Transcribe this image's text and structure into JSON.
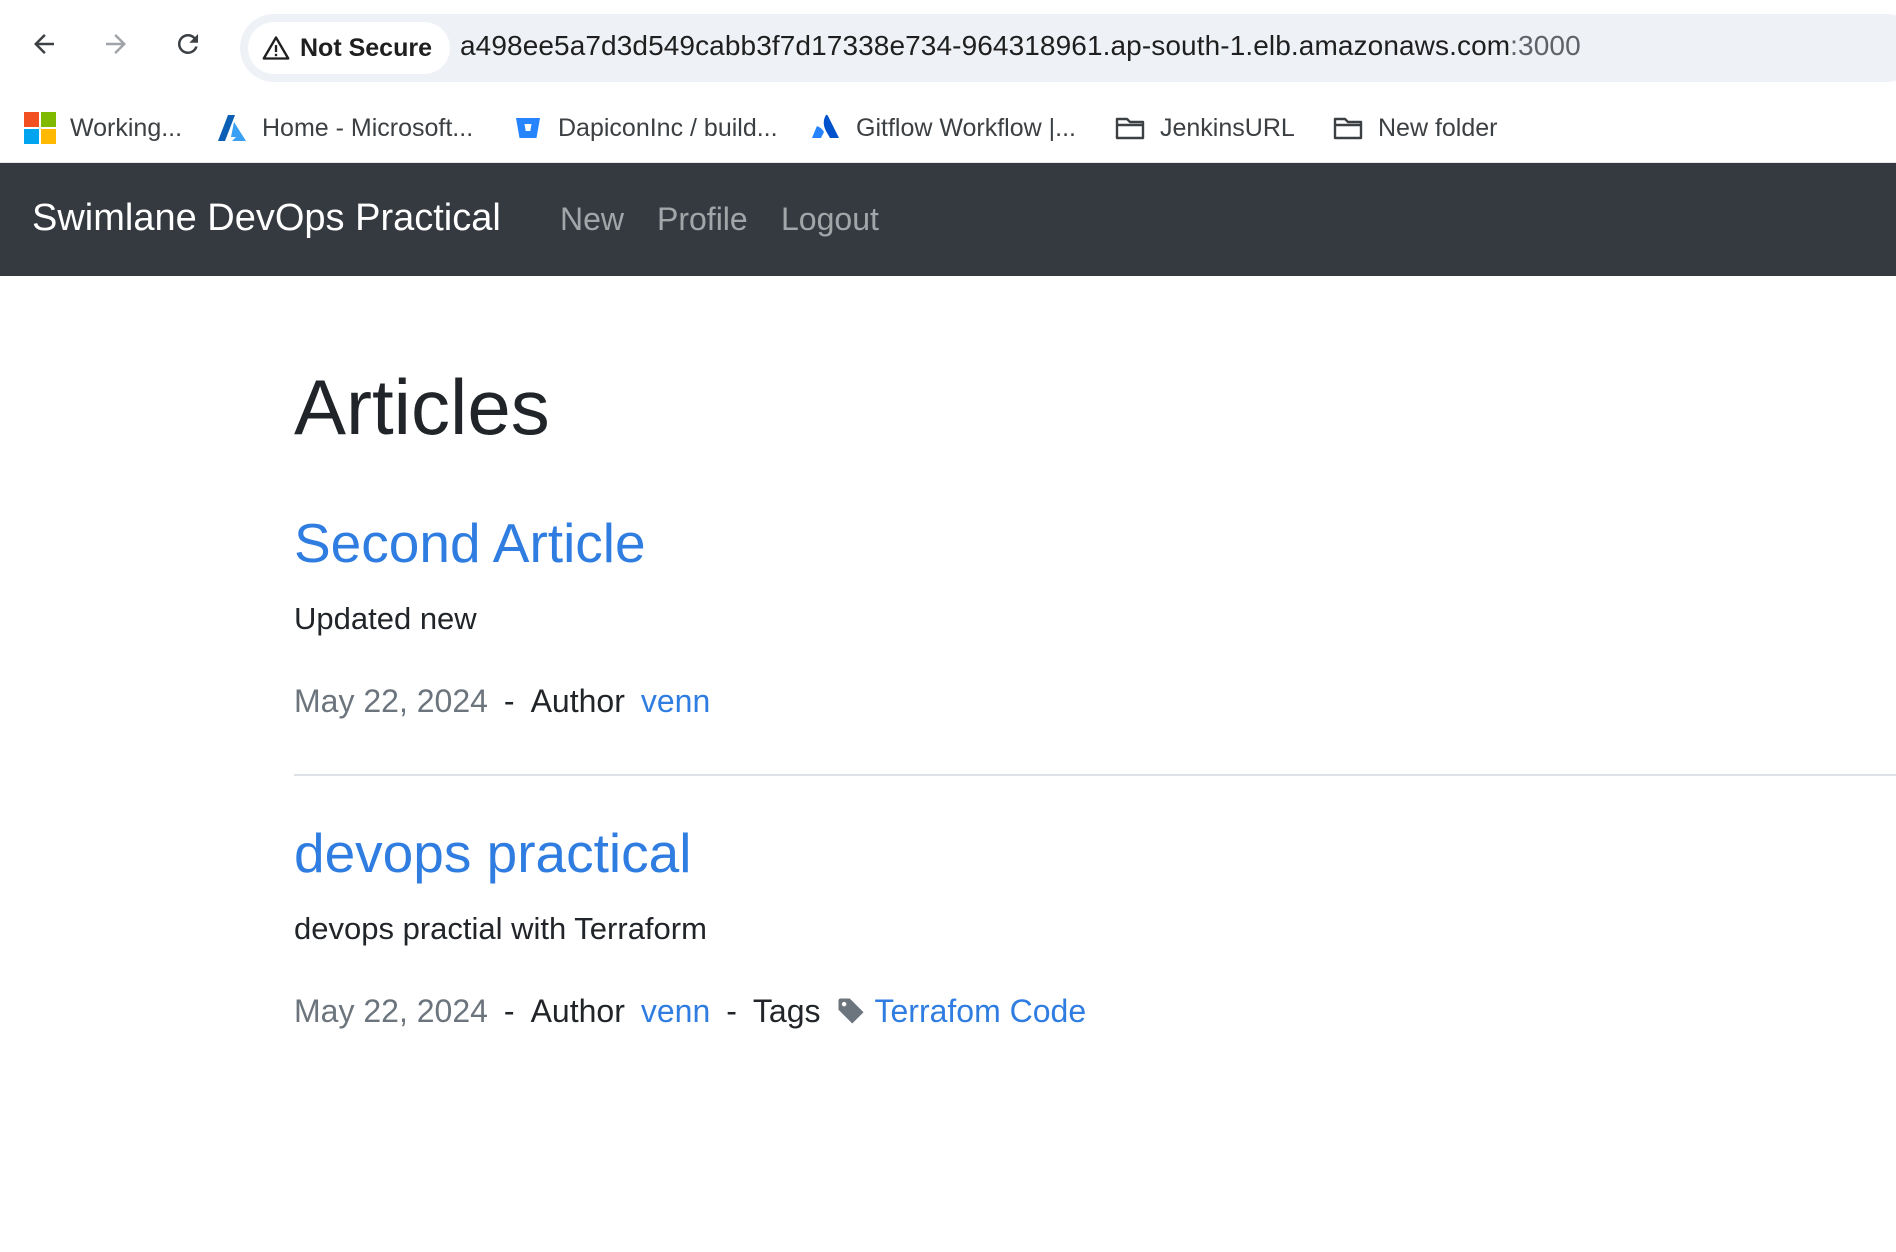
{
  "browser": {
    "security_label": "Not Secure",
    "url_host": "a498ee5a7d3d549cabb3f7d17338e734-964318961.ap-south-1.elb.amazonaws.com",
    "url_port": ":3000",
    "bookmarks": [
      {
        "label": "Working...",
        "icon": "microsoft-logo-icon"
      },
      {
        "label": "Home - Microsoft...",
        "icon": "azure-icon"
      },
      {
        "label": "DapiconInc / build...",
        "icon": "bitbucket-icon"
      },
      {
        "label": "Gitflow Workflow |...",
        "icon": "atlassian-icon"
      },
      {
        "label": "JenkinsURL",
        "icon": "folder-icon"
      },
      {
        "label": "New folder",
        "icon": "folder-icon"
      }
    ]
  },
  "navbar": {
    "brand": "Swimlane DevOps Practical",
    "links": [
      "New",
      "Profile",
      "Logout"
    ]
  },
  "page": {
    "title": "Articles"
  },
  "articles": [
    {
      "title": "Second Article",
      "description": "Updated new",
      "date": "May 22, 2024",
      "sep": "-",
      "author_label": "Author",
      "author": "venn"
    },
    {
      "title": "devops practical",
      "description": "devops practial with Terraform",
      "date": "May 22, 2024",
      "sep": "-",
      "author_label": "Author",
      "author": "venn",
      "sep2": "-",
      "tags_label": "Tags",
      "tag": "Terrafom Code",
      "tag_icon": "tag-icon"
    }
  ],
  "colors": {
    "navbar_bg": "#343a40",
    "link": "#2f7de1",
    "muted": "#6c757d"
  }
}
